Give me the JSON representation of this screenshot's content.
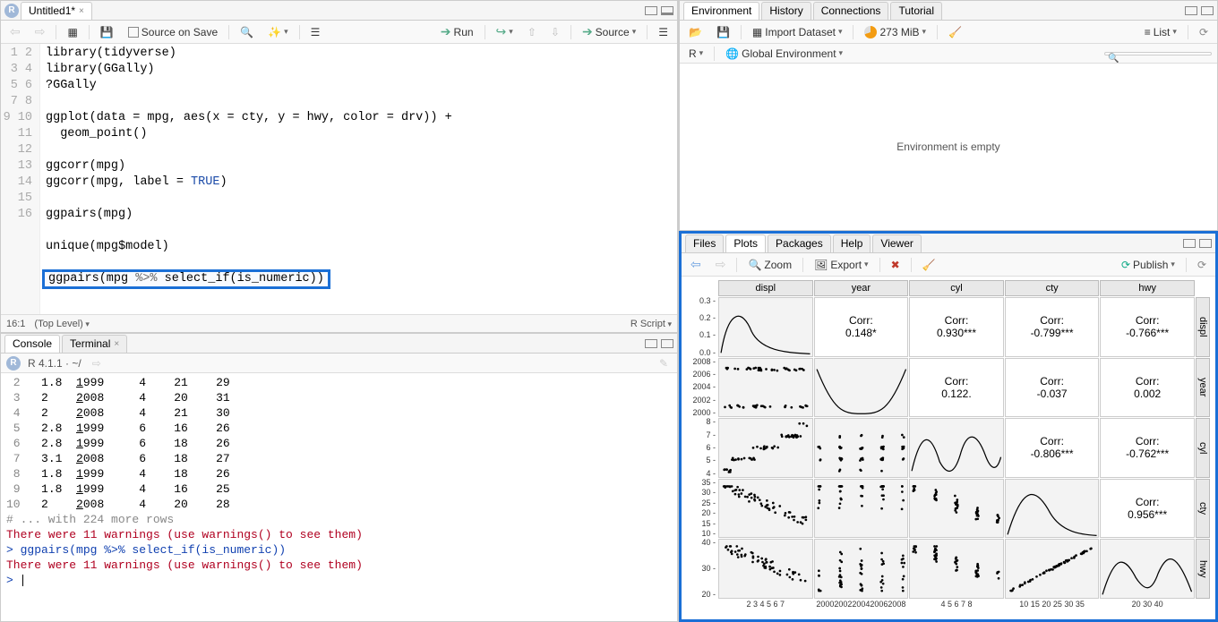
{
  "source": {
    "tab_title": "Untitled1*",
    "source_on_save": "Source on Save",
    "run_btn": "Run",
    "source_btn": "Source",
    "status_pos": "16:1",
    "status_scope": "(Top Level)",
    "status_lang": "R Script",
    "lines": [
      "library(tidyverse)",
      "library(GGally)",
      "?GGally",
      "",
      "ggplot(data = mpg, aes(x = cty, y = hwy, color = drv)) +",
      "  geom_point()",
      "",
      "ggcorr(mpg)",
      "ggcorr(mpg, label = TRUE)",
      "",
      "ggpairs(mpg)",
      "",
      "unique(mpg$model)",
      "",
      "ggpairs(mpg %>% select_if(is_numeric))",
      ""
    ]
  },
  "console": {
    "tabs": [
      "Console",
      "Terminal"
    ],
    "rver": "R 4.1.1 · ~/",
    "rows": [
      {
        "n": "2",
        "a": "1.8",
        "b": "1999",
        "c": "4",
        "d": "21",
        "e": "29"
      },
      {
        "n": "3",
        "a": "2  ",
        "b": "2008",
        "c": "4",
        "d": "20",
        "e": "31"
      },
      {
        "n": "4",
        "a": "2  ",
        "b": "2008",
        "c": "4",
        "d": "21",
        "e": "30"
      },
      {
        "n": "5",
        "a": "2.8",
        "b": "1999",
        "c": "6",
        "d": "16",
        "e": "26"
      },
      {
        "n": "6",
        "a": "2.8",
        "b": "1999",
        "c": "6",
        "d": "18",
        "e": "26"
      },
      {
        "n": "7",
        "a": "3.1",
        "b": "2008",
        "c": "6",
        "d": "18",
        "e": "27"
      },
      {
        "n": "8",
        "a": "1.8",
        "b": "1999",
        "c": "4",
        "d": "18",
        "e": "26"
      },
      {
        "n": "9",
        "a": "1.8",
        "b": "1999",
        "c": "4",
        "d": "16",
        "e": "25"
      },
      {
        "n": "10",
        "a": "2  ",
        "b": "2008",
        "c": "4",
        "d": "20",
        "e": "28"
      }
    ],
    "more_rows": "# ... with 224 more rows",
    "warn1": "There were 11 warnings (use warnings() to see them)",
    "cmd": "> ggpairs(mpg %>% select_if(is_numeric))",
    "warn2": "There were 11 warnings (use warnings() to see them)",
    "prompt": "> "
  },
  "env": {
    "tabs": [
      "Environment",
      "History",
      "Connections",
      "Tutorial"
    ],
    "import": "Import Dataset",
    "mem": "273 MiB",
    "list": "List",
    "rmenu": "R",
    "scope": "Global Environment",
    "empty": "Environment is empty",
    "search_ph": "",
    "plots_tabs": [
      "Files",
      "Plots",
      "Packages",
      "Help",
      "Viewer"
    ],
    "zoom": "Zoom",
    "export": "Export",
    "publish": "Publish"
  },
  "chart_data": {
    "type": "pairs-matrix",
    "variables": [
      "displ",
      "year",
      "cyl",
      "cty",
      "hwy"
    ],
    "correlations": {
      "displ_year": "0.148*",
      "displ_cyl": "0.930***",
      "displ_cty": "-0.799***",
      "displ_hwy": "-0.766***",
      "year_cyl": "0.122.",
      "year_cty": "-0.037",
      "year_hwy": "0.002",
      "cyl_cty": "-0.806***",
      "cyl_hwy": "-0.762***",
      "cty_hwy": "0.956***"
    },
    "axis_ticks": {
      "displ_y": [
        "0.3",
        "0.2",
        "0.1",
        "0.0"
      ],
      "year_y": [
        "2008",
        "2006",
        "2004",
        "2002",
        "2000"
      ],
      "cyl_y": [
        "8",
        "7",
        "6",
        "5",
        "4"
      ],
      "cty_y": [
        "35",
        "30",
        "25",
        "20",
        "15",
        "10"
      ],
      "hwy_y": [
        "40",
        "30",
        "20"
      ],
      "displ_x": "2 3 4 5 6 7",
      "year_x": "20002002200420062008",
      "cyl_x": "4 5 6 7 8",
      "cty_x": "10 15 20 25 30 35",
      "hwy_x": "20   30   40"
    },
    "corr_label": "Corr:"
  }
}
